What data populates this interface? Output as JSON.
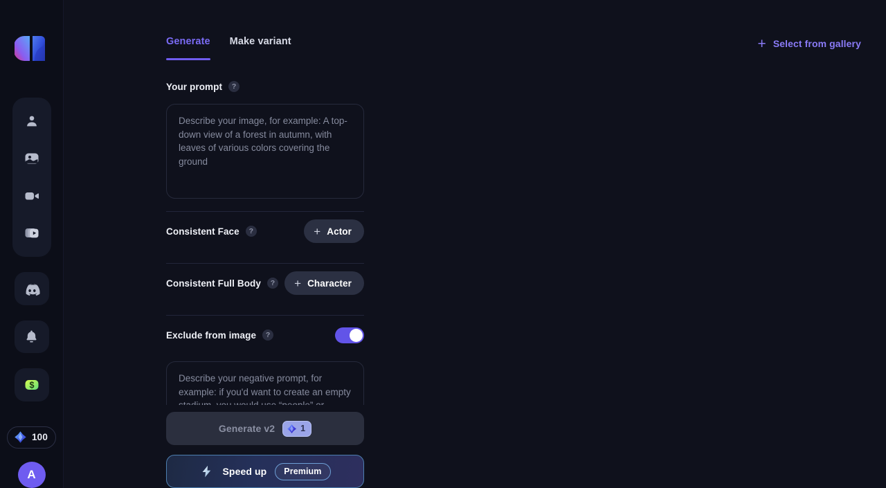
{
  "colors": {
    "bg": "#0f111c",
    "sidebar_bg": "#0c0e18",
    "accent_purple": "#6f5cf0",
    "tab_active": "#7a6bf5",
    "link_purple": "#8a7bf7",
    "toggle_on": "#6254e8",
    "money_green": "#b6f03c",
    "premium_border": "#6d9fd6"
  },
  "sidebar": {
    "logo_name": "app-logo",
    "nav_items": [
      {
        "icon": "person-icon",
        "name": "nav-profile"
      },
      {
        "icon": "image-icon",
        "name": "nav-images"
      },
      {
        "icon": "video-camera-icon",
        "name": "nav-video"
      },
      {
        "icon": "video-collection-icon",
        "name": "nav-collections"
      }
    ],
    "tiles": [
      {
        "icon": "discord-icon",
        "name": "discord-tile"
      },
      {
        "icon": "bell-icon",
        "name": "notifications-tile"
      },
      {
        "icon": "money-icon",
        "name": "earnings-tile"
      }
    ],
    "credits": {
      "icon": "gem-icon",
      "value": "100"
    },
    "avatar": {
      "initial": "A"
    }
  },
  "header": {
    "tabs": [
      {
        "label": "Generate",
        "active": true
      },
      {
        "label": "Make variant",
        "active": false
      }
    ],
    "gallery": {
      "plus": "+",
      "label": "Select from gallery"
    }
  },
  "form": {
    "prompt": {
      "label": "Your prompt",
      "help": "?",
      "value": "",
      "placeholder": "Describe your image, for example: A top-down view of a forest in autumn, with leaves of various colors covering the ground"
    },
    "consistent_face": {
      "label": "Consistent Face",
      "help": "?",
      "button_plus": "+",
      "button_label": "Actor"
    },
    "consistent_full_body": {
      "label": "Consistent Full Body",
      "help": "?",
      "button_plus": "+",
      "button_label": "Character"
    },
    "exclude": {
      "label": "Exclude from image",
      "help": "?",
      "toggle_on": true,
      "value": "",
      "placeholder": "Describe your negative prompt, for example: if you'd want to create an empty stadium, you would use “people” or “crowd” as negative prompt"
    }
  },
  "actions": {
    "generate": {
      "label": "Generate v2",
      "cost_icon": "gem-icon",
      "cost": "1",
      "disabled": true
    },
    "speed_up": {
      "icon": "lightning-bolt-icon",
      "label": "Speed up",
      "badge": "Premium"
    }
  }
}
